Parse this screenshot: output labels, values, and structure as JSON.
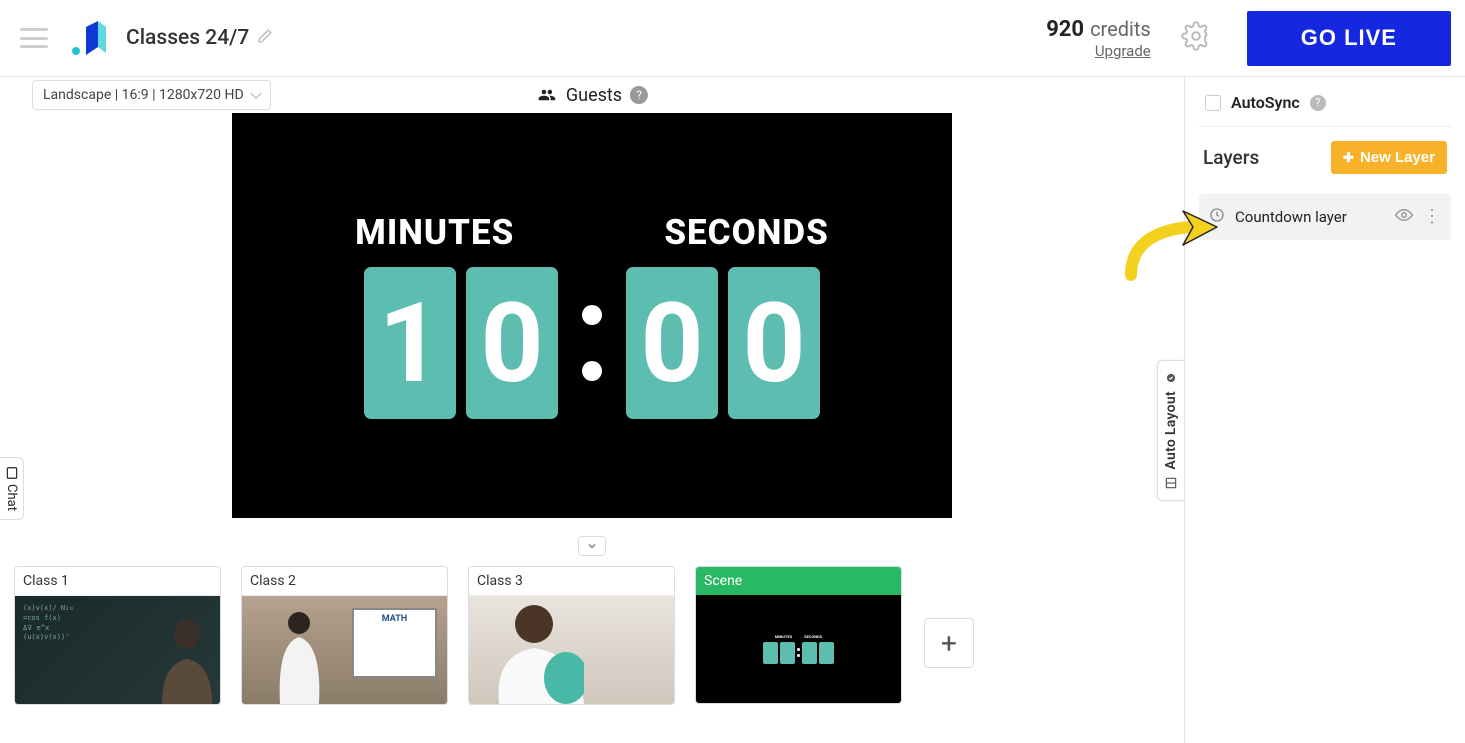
{
  "header": {
    "title": "Classes 24/7",
    "credits_num": "920",
    "credits_label": "credits",
    "upgrade": "Upgrade",
    "go_live": "GO LIVE"
  },
  "toolbar": {
    "resolution": "Landscape | 16:9 | 1280x720 HD",
    "guests_label": "Guests"
  },
  "countdown": {
    "minutes_label": "MINUTES",
    "seconds_label": "SECONDS",
    "d1": "1",
    "d2": "0",
    "d3": "0",
    "d4": "0"
  },
  "scenes": [
    {
      "title": "Class 1"
    },
    {
      "title": "Class 2"
    },
    {
      "title": "Class 3"
    },
    {
      "title": "Scene"
    }
  ],
  "right": {
    "autosync": "AutoSync",
    "layers_title": "Layers",
    "new_layer": "New Layer",
    "layer1": "Countdown layer",
    "auto_layout": "Auto Layout",
    "chat": "Chat"
  }
}
